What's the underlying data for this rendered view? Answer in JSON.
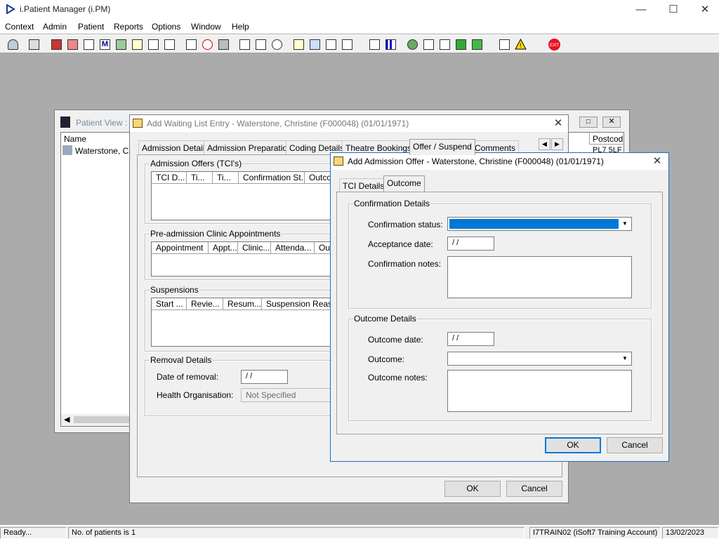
{
  "app": {
    "title": "i.Patient Manager (i.PM)"
  },
  "menu": [
    "Context",
    "Admin",
    "Patient",
    "Reports",
    "Options",
    "Window",
    "Help"
  ],
  "patient_view": {
    "title": "Patient View :",
    "columns": [
      "Name",
      "Postcod"
    ],
    "rows": [
      {
        "name": "Waterstone, Chri",
        "postcode": "PL7 5LF"
      }
    ]
  },
  "waiting_list": {
    "title": "Add Waiting List Entry - Waterstone, Christine (F000048) (01/01/1971)",
    "tabs": [
      "Admission Details",
      "Admission Preparation",
      "Coding Details",
      "Theatre Bookings",
      "Offer / Suspend",
      "Comments"
    ],
    "admission_offers": {
      "label": "Admission Offers (TCI's)",
      "columns": [
        "TCI D...",
        "Ti...",
        "Ti...",
        "Confirmation St...",
        "Outco"
      ]
    },
    "preadmission": {
      "label": "Pre-admission Clinic Appointments",
      "columns": [
        "Appointment",
        "Appt...",
        "Clinic...",
        "Attenda...",
        "Out"
      ]
    },
    "suspensions": {
      "label": "Suspensions",
      "columns": [
        "Start ...",
        "Revie...",
        "Resum...",
        "Suspension Reason"
      ]
    },
    "removal": {
      "label": "Removal Details",
      "date_label": "Date of removal:",
      "date_value": " / /",
      "health_org_label": "Health Organisation:",
      "health_org_value": "Not Specified"
    },
    "ok_label": "OK",
    "cancel_label": "Cancel"
  },
  "admission_offer": {
    "title": "Add Admission Offer  - Waterstone, Christine (F000048) (01/01/1971)",
    "tabs": [
      "TCI Details",
      "Outcome"
    ],
    "confirmation": {
      "label": "Confirmation Details",
      "status_label": "Confirmation status:",
      "acceptance_label": "Acceptance date:",
      "acceptance_value": " / /",
      "notes_label": "Confirmation notes:"
    },
    "outcome": {
      "label": "Outcome Details",
      "date_label": "Outcome date:",
      "date_value": " / /",
      "outcome_label": "Outcome:",
      "notes_label": "Outcome notes:"
    },
    "ok_label": "OK",
    "cancel_label": "Cancel"
  },
  "status": {
    "ready": "Ready...",
    "patients": "No. of patients is 1",
    "account": "I7TRAIN02 (iSoft7 Training Account)",
    "date": "13/02/2023"
  },
  "colors": {
    "selection": "#0078d7",
    "exit_red": "#e81123",
    "desktop": "#ababab"
  }
}
